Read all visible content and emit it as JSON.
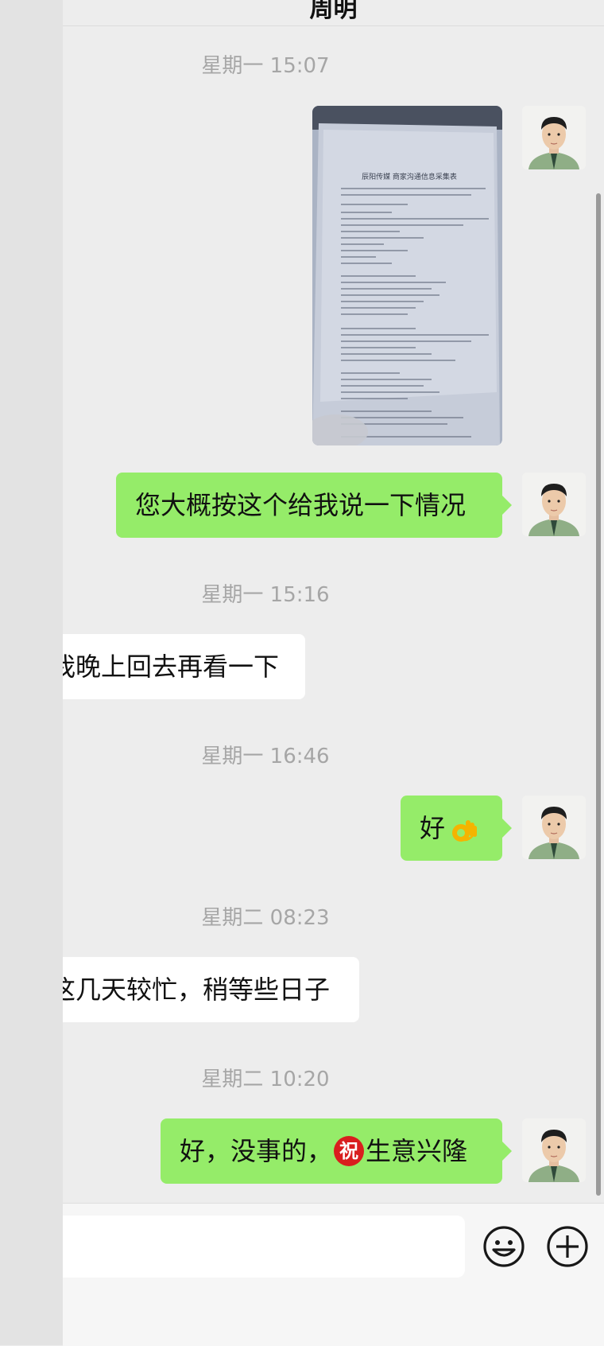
{
  "header": {
    "title": "周明"
  },
  "timestamps": [
    "星期一 15:07",
    "星期一 15:16",
    "星期一 16:46",
    "星期二 08:23",
    "星期二 10:20"
  ],
  "messages": {
    "m2": "您大概按这个给我说一下情况",
    "m3": "我晚上回去再看一下",
    "m4": "好",
    "m5": "这几天较忙，稍等些日子",
    "m6a": "好，没事的，",
    "m6_emoji": "祝",
    "m6b": "生意兴隆"
  },
  "photo": {
    "doc_title": "辰阳传媒  商家沟通信息采集表",
    "doc_sections": [
      "一、商家基础信息",
      "二、当前线上运营情况",
      "三、核心需求与合作目标",
      "四、营销推广关注点",
      "五、预算与合作意向",
      "六、其他补充信息"
    ]
  },
  "icons": {
    "emoji_button": "smiley-icon",
    "more_button": "plus-circle-icon"
  },
  "colors": {
    "outgoing_bubble": "#95ec69",
    "incoming_bubble": "#ffffff",
    "background": "#ededed"
  }
}
